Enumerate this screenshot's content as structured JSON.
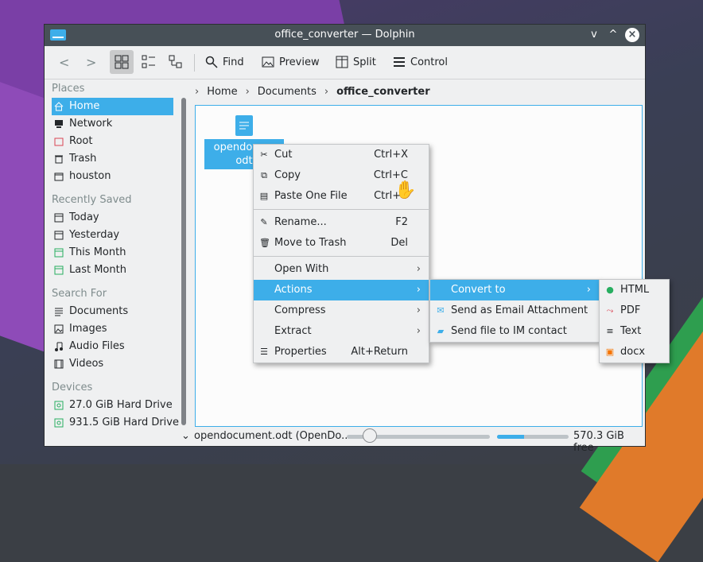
{
  "window": {
    "title": "office_converter — Dolphin",
    "controls": [
      "v",
      "^",
      "×"
    ]
  },
  "toolbar": {
    "back_label": "<",
    "forward_label": ">",
    "find_label": "Find",
    "preview_label": "Preview",
    "split_label": "Split",
    "control_label": "Control"
  },
  "sidebar": {
    "places_header": "Places",
    "places": [
      {
        "label": "Home",
        "icon": "home-icon",
        "selected": true
      },
      {
        "label": "Network",
        "icon": "network-icon"
      },
      {
        "label": "Root",
        "icon": "root-folder-icon"
      },
      {
        "label": "Trash",
        "icon": "trash-icon"
      },
      {
        "label": "houston",
        "icon": "folder-icon"
      }
    ],
    "recent_header": "Recently Saved",
    "recent": [
      {
        "label": "Today",
        "icon": "calendar-icon"
      },
      {
        "label": "Yesterday",
        "icon": "calendar-icon"
      },
      {
        "label": "This Month",
        "icon": "calendar-icon"
      },
      {
        "label": "Last Month",
        "icon": "calendar-icon"
      }
    ],
    "search_header": "Search For",
    "search": [
      {
        "label": "Documents",
        "icon": "document-icon"
      },
      {
        "label": "Images",
        "icon": "image-icon"
      },
      {
        "label": "Audio Files",
        "icon": "music-icon"
      },
      {
        "label": "Videos",
        "icon": "video-icon"
      }
    ],
    "devices_header": "Devices",
    "devices": [
      {
        "label": "27.0 GiB Hard Drive",
        "icon": "drive-icon"
      },
      {
        "label": "931.5 GiB Hard Drive",
        "icon": "drive-icon"
      }
    ]
  },
  "breadcrumb": {
    "items": [
      "Home",
      "Documents"
    ],
    "current": "office_converter"
  },
  "file": {
    "label_line1": "opendocum",
    "label_line2": "odt"
  },
  "statusbar": {
    "text": "opendocument.odt (OpenDo...",
    "free_space": "570.3 GiB free",
    "zoom_level_fraction": 0.16,
    "used_fraction": 0.38
  },
  "context_menu": {
    "items": [
      {
        "label": "Cut",
        "shortcut": "Ctrl+X",
        "icon": "cut-icon"
      },
      {
        "label": "Copy",
        "shortcut": "Ctrl+C",
        "icon": "copy-icon"
      },
      {
        "label": "Paste One File",
        "shortcut": "Ctrl+V",
        "icon": "paste-icon"
      },
      {
        "label": "Rename...",
        "shortcut": "F2",
        "icon": "rename-icon"
      },
      {
        "label": "Move to Trash",
        "shortcut": "Del",
        "icon": "trash-icon"
      },
      {
        "label": "Open With",
        "submenu": true
      },
      {
        "label": "Actions",
        "submenu": true,
        "highlighted": true
      },
      {
        "label": "Compress",
        "submenu": true
      },
      {
        "label": "Extract",
        "submenu": true
      },
      {
        "label": "Properties",
        "shortcut": "Alt+Return",
        "icon": "properties-icon"
      }
    ]
  },
  "actions_menu": {
    "items": [
      {
        "label": "Convert to",
        "submenu": true,
        "highlighted": true
      },
      {
        "label": "Send as Email Attachment",
        "icon": "email-icon"
      },
      {
        "label": "Send file to IM contact",
        "icon": "chat-icon"
      }
    ]
  },
  "convert_menu": {
    "items": [
      {
        "label": "HTML",
        "icon": "globe-icon"
      },
      {
        "label": "PDF",
        "icon": "pdf-icon"
      },
      {
        "label": "Text",
        "icon": "text-icon"
      },
      {
        "label": "docx",
        "icon": "docx-icon"
      }
    ]
  },
  "colors": {
    "accent": "#3daee9",
    "titlebar": "#475057",
    "window_bg": "#eff0f1"
  }
}
